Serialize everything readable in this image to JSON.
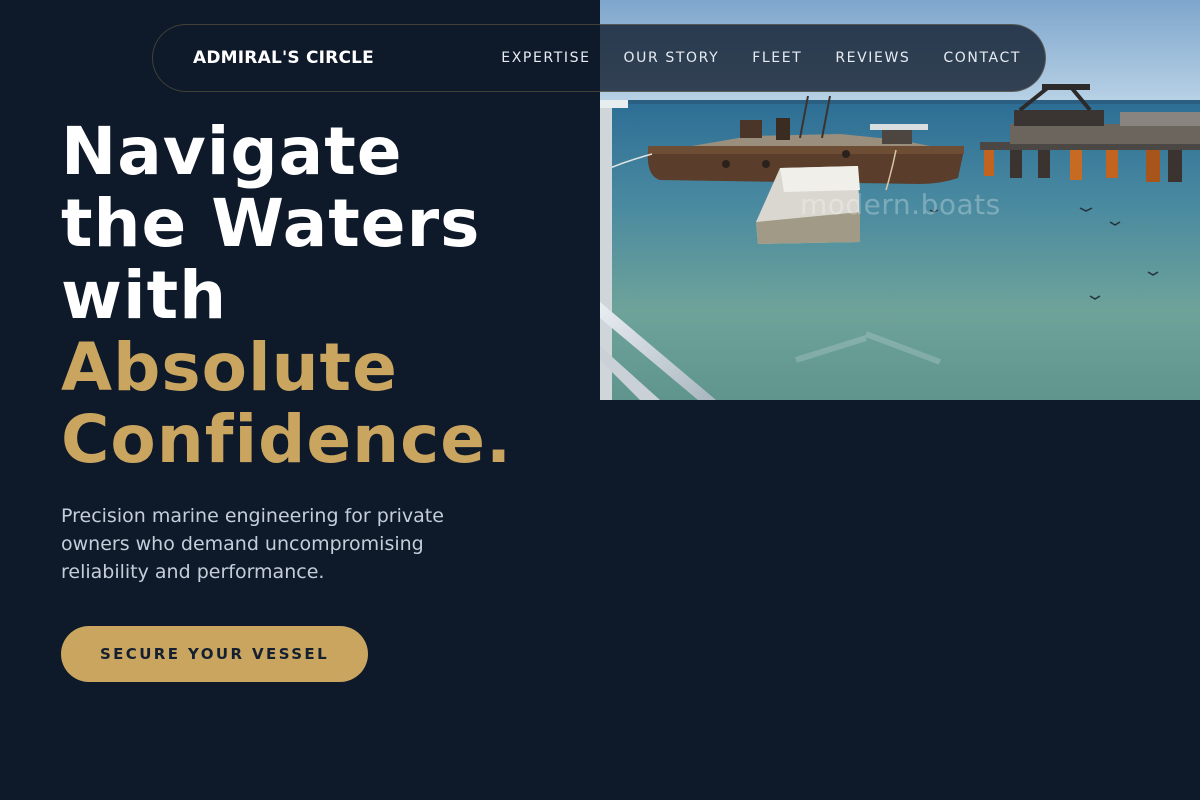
{
  "nav": {
    "brand": "ADMIRAL'S CIRCLE",
    "links": [
      "EXPERTISE",
      "OUR STORY",
      "FLEET",
      "REVIEWS",
      "CONTACT"
    ]
  },
  "hero": {
    "headline_lines": [
      "Navigate",
      "the Waters",
      "with"
    ],
    "headline_accent_lines": [
      "Absolute",
      "Confidence."
    ],
    "subtitle": "Precision marine engineering for private owners who demand uncompromising reliability and performance.",
    "cta_label": "SECURE YOUR VESSEL"
  },
  "photo": {
    "watermark": "modern.boats"
  },
  "colors": {
    "background": "#0e1a2a",
    "accent_gold": "#c9a560",
    "text_white": "#ffffff",
    "text_muted": "#c5cdd9"
  }
}
